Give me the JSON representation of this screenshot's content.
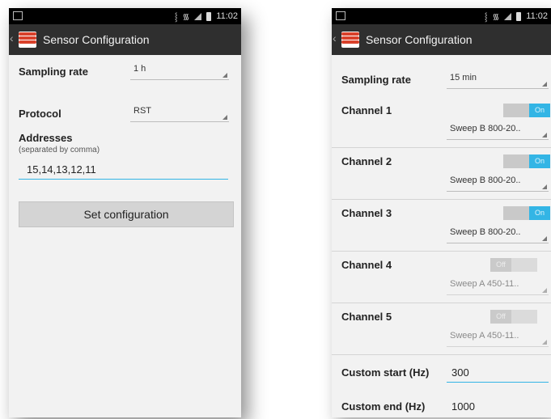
{
  "status_bar": {
    "time": "11:02"
  },
  "left_screen": {
    "title": "Sensor Configuration",
    "sampling_rate": {
      "label": "Sampling rate",
      "value": "1 h"
    },
    "protocol": {
      "label": "Protocol",
      "value": "RST"
    },
    "addresses": {
      "label": "Addresses",
      "hint": "(separated by comma)",
      "value": "15,14,13,12,11"
    },
    "set_button": "Set configuration"
  },
  "right_screen": {
    "title": "Sensor Configuration",
    "sampling_rate": {
      "label": "Sampling rate",
      "value": "15 min"
    },
    "channels": [
      {
        "label": "Channel 1",
        "toggle": "On",
        "sweep": "Sweep B 800-20.."
      },
      {
        "label": "Channel 2",
        "toggle": "On",
        "sweep": "Sweep B 800-20.."
      },
      {
        "label": "Channel 3",
        "toggle": "On",
        "sweep": "Sweep B 800-20.."
      },
      {
        "label": "Channel 4",
        "toggle": "Off",
        "sweep": "Sweep A 450-11.."
      },
      {
        "label": "Channel 5",
        "toggle": "Off",
        "sweep": "Sweep A 450-11.."
      }
    ],
    "custom_start": {
      "label": "Custom start (Hz)",
      "value": "300"
    },
    "custom_end": {
      "label": "Custom end (Hz)",
      "value": "1000"
    }
  },
  "colors": {
    "accent": "#33b5e5",
    "action_bar": "#2f2f2f",
    "logo_red": "#d9412b"
  },
  "icons": [
    "notification-icon",
    "vibrate-icon",
    "wifi-icon",
    "signal-icon",
    "battery-icon",
    "back-chevron-icon",
    "app-logo-icon",
    "dropdown-triangle-icon"
  ]
}
